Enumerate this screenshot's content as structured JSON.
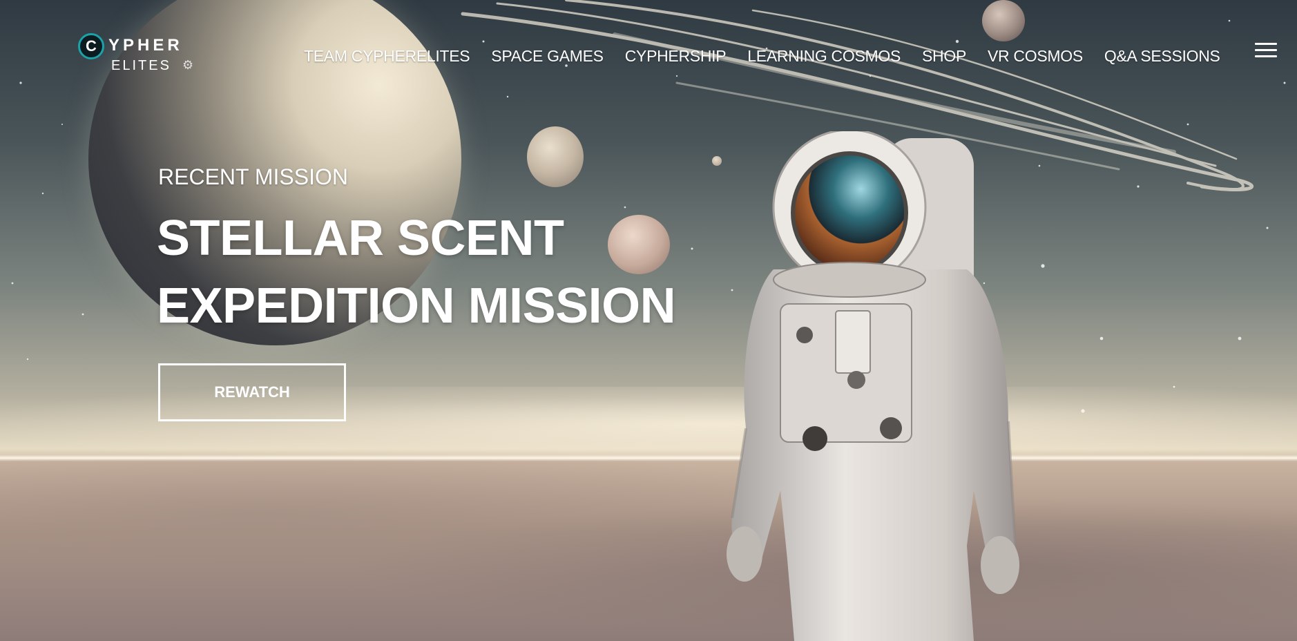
{
  "brand": {
    "logo_letter": "C",
    "logo_name": "YPHER",
    "logo_sub": "ELITES",
    "accent_color": "#1aa3a8"
  },
  "nav": {
    "items": [
      {
        "label": "TEAM CYPHERELITES"
      },
      {
        "label": "SPACE GAMES"
      },
      {
        "label": "CYPHERSHIP"
      },
      {
        "label": "LEARNING COSMOS"
      },
      {
        "label": "SHOP"
      },
      {
        "label": "VR COSMOS"
      },
      {
        "label": "Q&A SESSIONS"
      }
    ],
    "menu_icon": "hamburger-icon"
  },
  "hero": {
    "eyebrow": "RECENT MISSION",
    "headline_line1": "STELLAR SCENT",
    "headline_line2": "EXPEDITION MISSION",
    "cta_label": "REWATCH"
  },
  "background": {
    "description_icon": "astronaut-on-planet-scene"
  }
}
